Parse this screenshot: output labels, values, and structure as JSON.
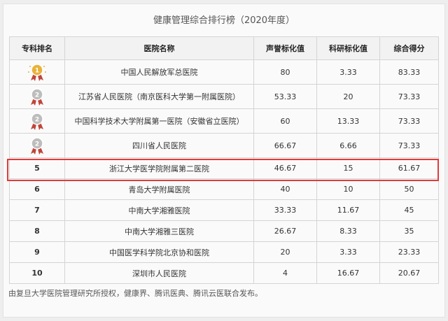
{
  "title": "健康管理综合排行榜（2020年度）",
  "columns": [
    "专科排名",
    "医院名称",
    "声誉标化值",
    "科研标化值",
    "综合得分"
  ],
  "rows": [
    {
      "rank": "",
      "medal_label": "1",
      "medal_color": "#e8b23a",
      "name": "中国人民解放军总医院",
      "reputation": "80",
      "research": "3.33",
      "score": "83.33"
    },
    {
      "rank": "",
      "medal_label": "2",
      "medal_color": "#bdbdbd",
      "name": "江苏省人民医院（南京医科大学第一附属医院）",
      "reputation": "53.33",
      "research": "20",
      "score": "73.33"
    },
    {
      "rank": "",
      "medal_label": "2",
      "medal_color": "#bdbdbd",
      "name": "中国科学技术大学附属第一医院（安徽省立医院）",
      "reputation": "60",
      "research": "13.33",
      "score": "73.33"
    },
    {
      "rank": "",
      "medal_label": "2",
      "medal_color": "#bdbdbd",
      "name": "四川省人民医院",
      "reputation": "66.67",
      "research": "6.66",
      "score": "73.33"
    },
    {
      "rank": "5",
      "name": "浙江大学医学院附属第二医院",
      "reputation": "46.67",
      "research": "15",
      "score": "61.67"
    },
    {
      "rank": "6",
      "name": "青岛大学附属医院",
      "reputation": "40",
      "research": "10",
      "score": "50"
    },
    {
      "rank": "7",
      "name": "中南大学湘雅医院",
      "reputation": "33.33",
      "research": "11.67",
      "score": "45"
    },
    {
      "rank": "8",
      "name": "中南大学湘雅三医院",
      "reputation": "26.67",
      "research": "8.33",
      "score": "35"
    },
    {
      "rank": "9",
      "name": "中国医学科学院北京协和医院",
      "reputation": "20",
      "research": "3.33",
      "score": "23.33"
    },
    {
      "rank": "10",
      "name": "深圳市人民医院",
      "reputation": "4",
      "research": "16.67",
      "score": "20.67"
    }
  ],
  "highlight_color": "#e23a3a",
  "footer": "由复旦大学医院管理研究所授权，健康界、腾讯医典、腾讯云医联合发布。"
}
